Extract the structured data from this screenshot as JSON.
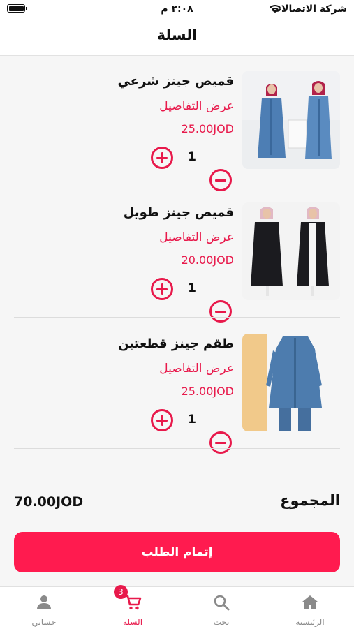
{
  "status_bar": {
    "time": "٢:٠٨ م",
    "carrier": "شركة الاتصالات"
  },
  "header": {
    "title": "السلة"
  },
  "cart": {
    "items": [
      {
        "name": "قميص جينز شرعي",
        "details_label": "عرض التفاصيل",
        "price": "25.00JOD",
        "quantity": "1",
        "image_palette": "denim"
      },
      {
        "name": "قميص جينز طويل",
        "details_label": "عرض التفاصيل",
        "price": "20.00JOD",
        "quantity": "1",
        "image_palette": "black"
      },
      {
        "name": "طقم جينز قطعتين",
        "details_label": "عرض التفاصيل",
        "price": "25.00JOD",
        "quantity": "1",
        "image_palette": "denim-beige"
      }
    ],
    "total_label": "المجموع",
    "total_value": "70.00JOD",
    "checkout_label": "إتمام الطلب"
  },
  "tab_bar": {
    "tabs": [
      {
        "label": "الرئيسية",
        "icon": "home-icon",
        "active": false
      },
      {
        "label": "بحث",
        "icon": "search-icon",
        "active": false
      },
      {
        "label": "السلة",
        "icon": "cart-icon",
        "active": true,
        "badge": "3"
      },
      {
        "label": "حسابي",
        "icon": "person-icon",
        "active": false
      }
    ]
  },
  "colors": {
    "accent": "#e8194b",
    "button": "#ff1b4f",
    "background": "#f6f6f6"
  }
}
